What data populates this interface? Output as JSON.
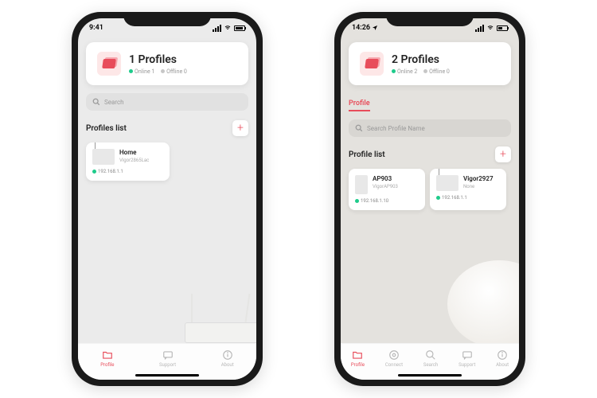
{
  "phones": [
    {
      "time": "9:41",
      "header": {
        "title": "1 Profiles",
        "online": "Online 1",
        "offline": "Offline 0"
      },
      "search_placeholder": "Search",
      "list_title": "Profiles list",
      "add_symbol": "+",
      "cards": [
        {
          "name": "Home",
          "model": "Vigor2865Lac",
          "ip": "192.168.1.1",
          "img": "router"
        }
      ],
      "nav": [
        {
          "label": "Profile",
          "icon": "folder",
          "active": true
        },
        {
          "label": "Support",
          "icon": "chat",
          "active": false
        },
        {
          "label": "About",
          "icon": "info",
          "active": false
        }
      ]
    },
    {
      "time": "14:26",
      "header": {
        "title": "2 Profiles",
        "online": "Online 2",
        "offline": "Offline 0"
      },
      "tab_label": "Profile",
      "search_placeholder": "Search Profile Name",
      "list_title": "Profile list",
      "add_symbol": "+",
      "cards": [
        {
          "name": "AP903",
          "model": "VigorAP903",
          "ip": "192.168.1.10",
          "img": "ap"
        },
        {
          "name": "Vigor2927",
          "model": "None",
          "ip": "192.168.1.1",
          "img": "router"
        }
      ],
      "nav": [
        {
          "label": "Profile",
          "icon": "folder",
          "active": true
        },
        {
          "label": "Connect",
          "icon": "connect",
          "active": false
        },
        {
          "label": "Search",
          "icon": "search",
          "active": false
        },
        {
          "label": "Support",
          "icon": "chat",
          "active": false
        },
        {
          "label": "About",
          "icon": "info",
          "active": false
        }
      ]
    }
  ]
}
